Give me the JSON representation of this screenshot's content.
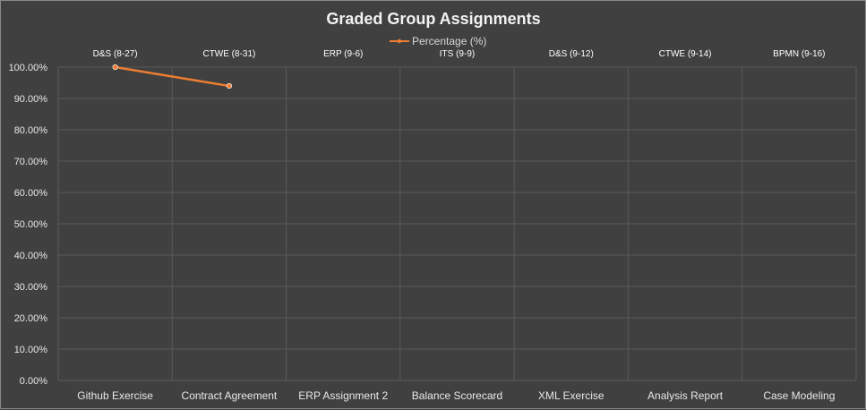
{
  "chart_data": {
    "type": "line",
    "title": "Graded Group Assignments",
    "categories": [
      "Github Exercise",
      "Contract Agreement",
      "ERP Assignment 2",
      "Balance Scorecard",
      "XML Exercise",
      "Analysis Report",
      "Case Modeling"
    ],
    "top_labels": [
      "D&S (8-27)",
      "CTWE (8-31)",
      "ERP (9-6)",
      "ITS (9-9)",
      "D&S (9-12)",
      "CTWE (9-14)",
      "BPMN (9-16)"
    ],
    "series": [
      {
        "name": "Percentage (%)",
        "values": [
          1.0,
          0.94,
          null,
          null,
          null,
          null,
          null
        ],
        "color": "#ed7d31"
      }
    ],
    "ylim": [
      0,
      1.0
    ],
    "yticks": [
      "0.00%",
      "10.00%",
      "20.00%",
      "30.00%",
      "40.00%",
      "50.00%",
      "60.00%",
      "70.00%",
      "80.00%",
      "90.00%",
      "100.00%"
    ],
    "legend_position": "top",
    "grid": true,
    "background": "#404040",
    "gridline_color": "#5a5a5a"
  }
}
